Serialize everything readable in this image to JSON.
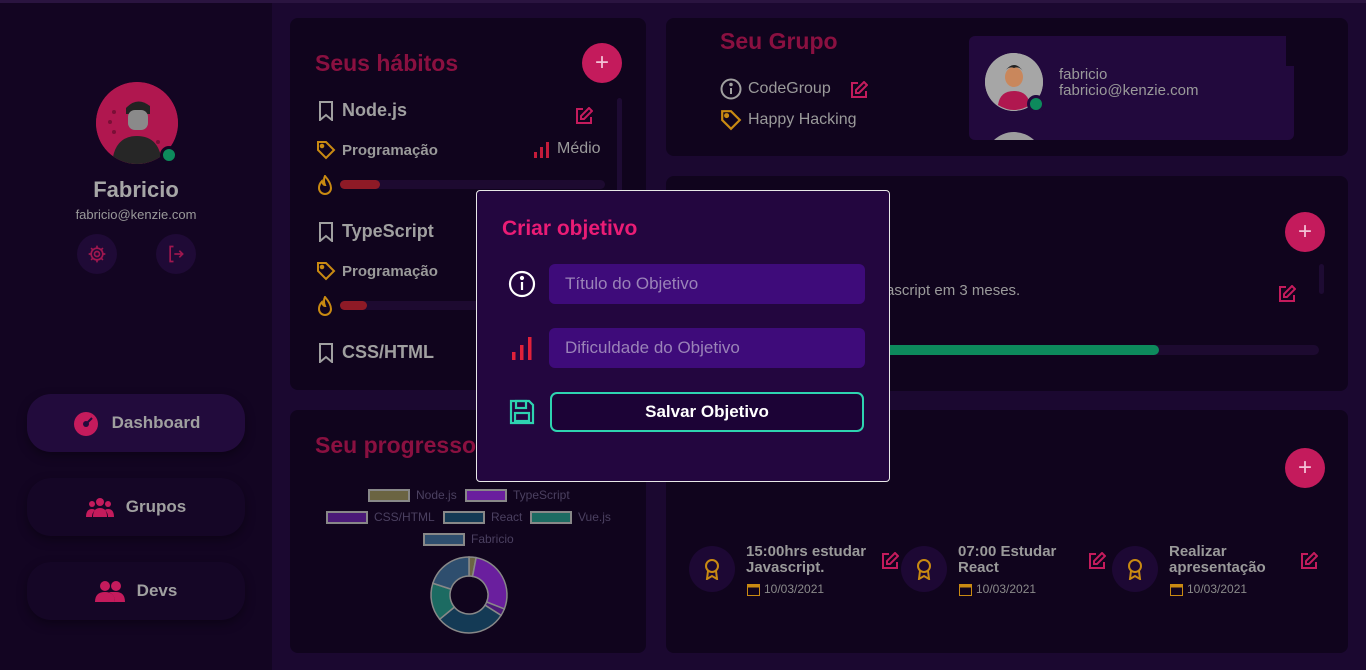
{
  "profile": {
    "name": "Fabricio",
    "email": "fabricio@kenzie.com"
  },
  "nav": {
    "dashboard": "Dashboard",
    "groups": "Grupos",
    "devs": "Devs"
  },
  "habits": {
    "title": "Seus hábitos",
    "items": [
      {
        "name": "Node.js",
        "category": "Programação",
        "difficulty": "Médio",
        "progress": 0.15
      },
      {
        "name": "TypeScript",
        "category": "Programação",
        "progress": 0.18
      },
      {
        "name": "CSS/HTML"
      }
    ]
  },
  "progress_panel": {
    "title": "Seu progresso",
    "legend": [
      "Node.js",
      "TypeScript",
      "CSS/HTML",
      "React",
      "Vue.js",
      "Fabricio"
    ]
  },
  "chart_data": {
    "type": "pie",
    "labels": [
      "Node.js",
      "TypeScript",
      "CSS/HTML",
      "React",
      "Vue.js",
      "Fabricio"
    ],
    "values": [
      3,
      28,
      3,
      30,
      16,
      20
    ],
    "colors": [
      "#6b6442",
      "#6a1f9e",
      "#4b1a78",
      "#143a55",
      "#1c6b62",
      "#2e4e6e"
    ]
  },
  "group": {
    "title": "Seu Grupo",
    "name": "CodeGroup",
    "category": "Happy Hacking",
    "member": {
      "name": "fabricio",
      "email": "fabricio@kenzie.com"
    }
  },
  "goal_panel": {
    "text": "ascript em 3 meses.",
    "progress": 0.71
  },
  "activities": [
    {
      "title": "15:00hrs estudar Javascript.",
      "date": "10/03/2021"
    },
    {
      "title": "07:00 Estudar React",
      "date": "10/03/2021"
    },
    {
      "title": "Realizar apresentação",
      "date": "10/03/2021"
    }
  ],
  "modal": {
    "title": "Criar objetivo",
    "title_placeholder": "Título do Objetivo",
    "difficulty_placeholder": "Dificuldade do Objetivo",
    "save_label": "Salvar Objetivo"
  },
  "colors": {
    "accent": "#c41b5c",
    "modal_accent": "#ea1c75",
    "success": "#0d8a5c",
    "teal": "#2ed3b0"
  }
}
